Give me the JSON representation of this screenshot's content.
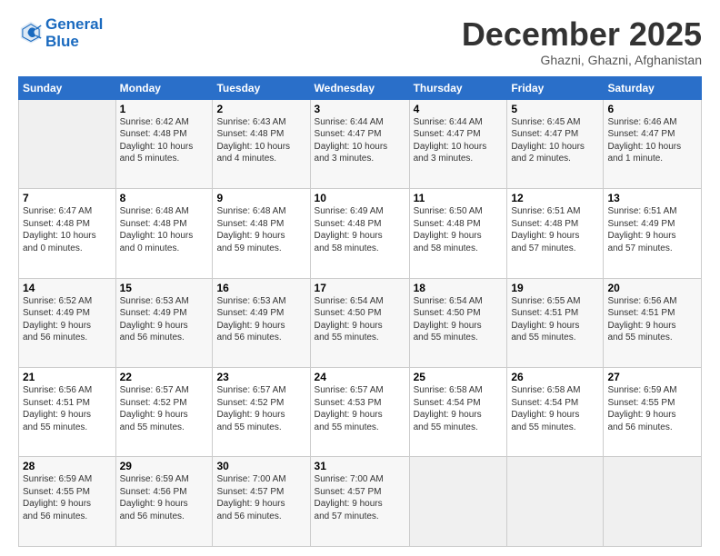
{
  "logo": {
    "line1": "General",
    "line2": "Blue"
  },
  "title": "December 2025",
  "location": "Ghazni, Ghazni, Afghanistan",
  "days_header": [
    "Sunday",
    "Monday",
    "Tuesday",
    "Wednesday",
    "Thursday",
    "Friday",
    "Saturday"
  ],
  "weeks": [
    [
      {
        "num": "",
        "info": ""
      },
      {
        "num": "1",
        "info": "Sunrise: 6:42 AM\nSunset: 4:48 PM\nDaylight: 10 hours\nand 5 minutes."
      },
      {
        "num": "2",
        "info": "Sunrise: 6:43 AM\nSunset: 4:48 PM\nDaylight: 10 hours\nand 4 minutes."
      },
      {
        "num": "3",
        "info": "Sunrise: 6:44 AM\nSunset: 4:47 PM\nDaylight: 10 hours\nand 3 minutes."
      },
      {
        "num": "4",
        "info": "Sunrise: 6:44 AM\nSunset: 4:47 PM\nDaylight: 10 hours\nand 3 minutes."
      },
      {
        "num": "5",
        "info": "Sunrise: 6:45 AM\nSunset: 4:47 PM\nDaylight: 10 hours\nand 2 minutes."
      },
      {
        "num": "6",
        "info": "Sunrise: 6:46 AM\nSunset: 4:47 PM\nDaylight: 10 hours\nand 1 minute."
      }
    ],
    [
      {
        "num": "7",
        "info": "Sunrise: 6:47 AM\nSunset: 4:48 PM\nDaylight: 10 hours\nand 0 minutes."
      },
      {
        "num": "8",
        "info": "Sunrise: 6:48 AM\nSunset: 4:48 PM\nDaylight: 10 hours\nand 0 minutes."
      },
      {
        "num": "9",
        "info": "Sunrise: 6:48 AM\nSunset: 4:48 PM\nDaylight: 9 hours\nand 59 minutes."
      },
      {
        "num": "10",
        "info": "Sunrise: 6:49 AM\nSunset: 4:48 PM\nDaylight: 9 hours\nand 58 minutes."
      },
      {
        "num": "11",
        "info": "Sunrise: 6:50 AM\nSunset: 4:48 PM\nDaylight: 9 hours\nand 58 minutes."
      },
      {
        "num": "12",
        "info": "Sunrise: 6:51 AM\nSunset: 4:48 PM\nDaylight: 9 hours\nand 57 minutes."
      },
      {
        "num": "13",
        "info": "Sunrise: 6:51 AM\nSunset: 4:49 PM\nDaylight: 9 hours\nand 57 minutes."
      }
    ],
    [
      {
        "num": "14",
        "info": "Sunrise: 6:52 AM\nSunset: 4:49 PM\nDaylight: 9 hours\nand 56 minutes."
      },
      {
        "num": "15",
        "info": "Sunrise: 6:53 AM\nSunset: 4:49 PM\nDaylight: 9 hours\nand 56 minutes."
      },
      {
        "num": "16",
        "info": "Sunrise: 6:53 AM\nSunset: 4:49 PM\nDaylight: 9 hours\nand 56 minutes."
      },
      {
        "num": "17",
        "info": "Sunrise: 6:54 AM\nSunset: 4:50 PM\nDaylight: 9 hours\nand 55 minutes."
      },
      {
        "num": "18",
        "info": "Sunrise: 6:54 AM\nSunset: 4:50 PM\nDaylight: 9 hours\nand 55 minutes."
      },
      {
        "num": "19",
        "info": "Sunrise: 6:55 AM\nSunset: 4:51 PM\nDaylight: 9 hours\nand 55 minutes."
      },
      {
        "num": "20",
        "info": "Sunrise: 6:56 AM\nSunset: 4:51 PM\nDaylight: 9 hours\nand 55 minutes."
      }
    ],
    [
      {
        "num": "21",
        "info": "Sunrise: 6:56 AM\nSunset: 4:51 PM\nDaylight: 9 hours\nand 55 minutes."
      },
      {
        "num": "22",
        "info": "Sunrise: 6:57 AM\nSunset: 4:52 PM\nDaylight: 9 hours\nand 55 minutes."
      },
      {
        "num": "23",
        "info": "Sunrise: 6:57 AM\nSunset: 4:52 PM\nDaylight: 9 hours\nand 55 minutes."
      },
      {
        "num": "24",
        "info": "Sunrise: 6:57 AM\nSunset: 4:53 PM\nDaylight: 9 hours\nand 55 minutes."
      },
      {
        "num": "25",
        "info": "Sunrise: 6:58 AM\nSunset: 4:54 PM\nDaylight: 9 hours\nand 55 minutes."
      },
      {
        "num": "26",
        "info": "Sunrise: 6:58 AM\nSunset: 4:54 PM\nDaylight: 9 hours\nand 55 minutes."
      },
      {
        "num": "27",
        "info": "Sunrise: 6:59 AM\nSunset: 4:55 PM\nDaylight: 9 hours\nand 56 minutes."
      }
    ],
    [
      {
        "num": "28",
        "info": "Sunrise: 6:59 AM\nSunset: 4:55 PM\nDaylight: 9 hours\nand 56 minutes."
      },
      {
        "num": "29",
        "info": "Sunrise: 6:59 AM\nSunset: 4:56 PM\nDaylight: 9 hours\nand 56 minutes."
      },
      {
        "num": "30",
        "info": "Sunrise: 7:00 AM\nSunset: 4:57 PM\nDaylight: 9 hours\nand 56 minutes."
      },
      {
        "num": "31",
        "info": "Sunrise: 7:00 AM\nSunset: 4:57 PM\nDaylight: 9 hours\nand 57 minutes."
      },
      {
        "num": "",
        "info": ""
      },
      {
        "num": "",
        "info": ""
      },
      {
        "num": "",
        "info": ""
      }
    ]
  ]
}
